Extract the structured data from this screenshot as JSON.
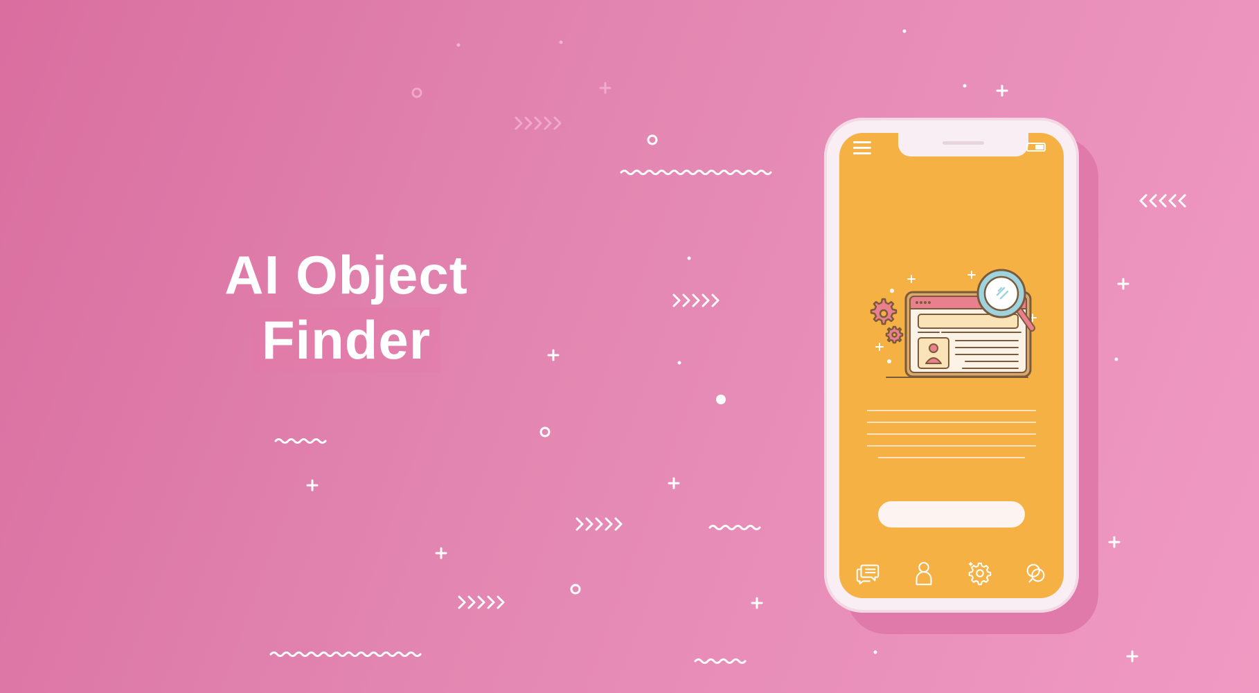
{
  "hero": {
    "title_line1": "AI Object",
    "title_line2": "Finder"
  },
  "colors": {
    "background_start": "#d96e9f",
    "background_end": "#f09ac3",
    "screen": "#f5b144",
    "accent_pink": "#ea7f8e",
    "accent_blue": "#9fd3dd",
    "outline": "#7a5a3a"
  },
  "phone": {
    "status_left_icon": "menu-icon",
    "status_right_icon": "battery-icon",
    "illustration": "browser-window-with-magnifier-icon",
    "tabs": [
      {
        "icon": "chat-icon"
      },
      {
        "icon": "user-icon"
      },
      {
        "icon": "gear-icon"
      },
      {
        "icon": "search-icon"
      }
    ]
  }
}
